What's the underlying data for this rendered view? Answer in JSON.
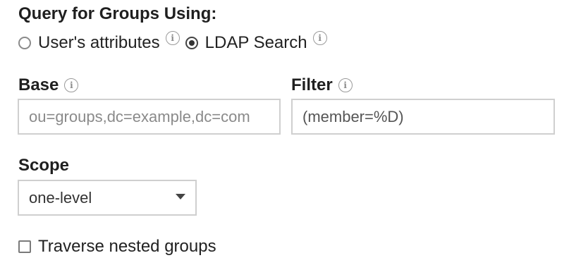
{
  "query_section": {
    "title": "Query for Groups Using:",
    "options": [
      {
        "label": "User's attributes",
        "selected": false
      },
      {
        "label": "LDAP Search",
        "selected": true
      }
    ]
  },
  "base": {
    "label": "Base",
    "placeholder": "ou=groups,dc=example,dc=com",
    "value": ""
  },
  "filter": {
    "label": "Filter",
    "value": "(member=%D)"
  },
  "scope": {
    "label": "Scope",
    "selected": "one-level"
  },
  "traverse": {
    "label": "Traverse nested groups",
    "checked": false
  },
  "icons": {
    "info": "info-icon"
  },
  "colors": {
    "border": "#cfcfcf",
    "placeholder": "#8a8a8a",
    "text": "#222222"
  }
}
